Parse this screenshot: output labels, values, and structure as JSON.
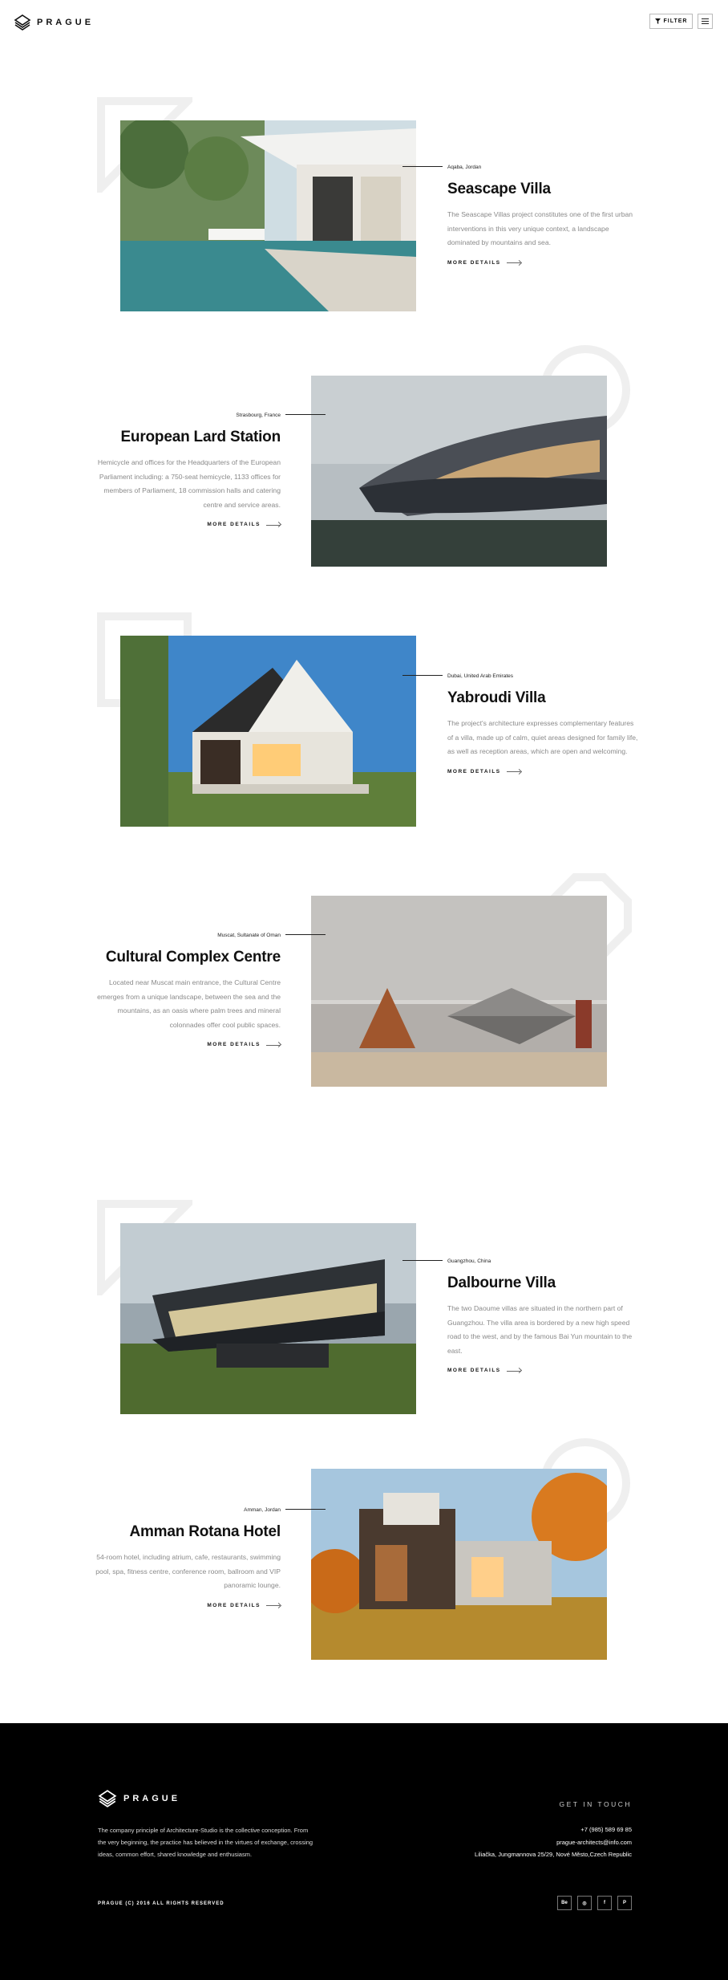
{
  "header": {
    "logo_text": "PRAGUE",
    "filter_label": "FILTER"
  },
  "projects": [
    {
      "location": "Aqaba, Jordan",
      "title": "Seascape Villa",
      "description": "The Seascape Villas project constitutes one of the first urban interventions in this very unique context, a landscape dominated by mountains and sea.",
      "more_label": "MORE DETAILS"
    },
    {
      "location": "Strasbourg, France",
      "title": "European Lard Station",
      "description": "Hemicycle and offices for the Headquarters of the European Parliament including: a 750-seat hemicycle, 1133 offices for members of Parliament, 18 commission halls and catering centre and service areas.",
      "more_label": "MORE DETAILS"
    },
    {
      "location": "Dubai, United Arab Emirates",
      "title": "Yabroudi Villa",
      "description": "The project's architecture expresses complementary features of a villa, made up of calm, quiet areas designed for family life, as well as reception areas, which are open and welcoming.",
      "more_label": "MORE DETAILS"
    },
    {
      "location": "Muscat, Sultanate of Oman",
      "title": "Cultural Complex Centre",
      "description": "Located near Muscat main entrance, the Cultural Centre emerges from a unique landscape, between the sea and the mountains, as an oasis where palm trees and mineral colonnades offer cool public spaces.",
      "more_label": "MORE DETAILS"
    },
    {
      "location": "Guangzhou, China",
      "title": "Dalbourne Villa",
      "description": "The two Daoume villas are situated in the northern part of Guangzhou. The villa area is bordered by a new high speed road to the west, and by the famous Bai Yun mountain to the east.",
      "more_label": "MORE DETAILS"
    },
    {
      "location": "Amman, Jordan",
      "title": "Amman Rotana Hotel",
      "description": "54-room hotel, including atrium, cafe, restaurants, swimming pool, spa, fitness centre, conference room, ballroom and VIP panoramic lounge.",
      "more_label": "MORE DETAILS"
    }
  ],
  "footer": {
    "logo_text": "PRAGUE",
    "about": "The company principle of Architecture-Studio is the collective conception. From the very beginning, the practice has believed in the virtues of exchange, crossing ideas, common effort, shared knowledge and enthusiasm.",
    "get_in_touch": "GET IN TOUCH",
    "phone": "+7 (985) 589 69 85",
    "email": "prague-architects@info.com",
    "address": "Liliačka, Jungmannova 25/29, Nové Město,Czech Republic",
    "copyright": "PRAGUE (C) 2016 ALL RIGHTS RESERVED",
    "socials": [
      "Be",
      "◎",
      "f",
      "P"
    ]
  },
  "colors": {
    "accent": "#111111",
    "footer_bg": "#000000",
    "muted_text": "#8a8a8a"
  },
  "icons": {
    "logo": "layered-diamond-icon",
    "filter": "funnel-icon",
    "menu": "hamburger-icon",
    "arrow": "arrow-right-icon"
  }
}
